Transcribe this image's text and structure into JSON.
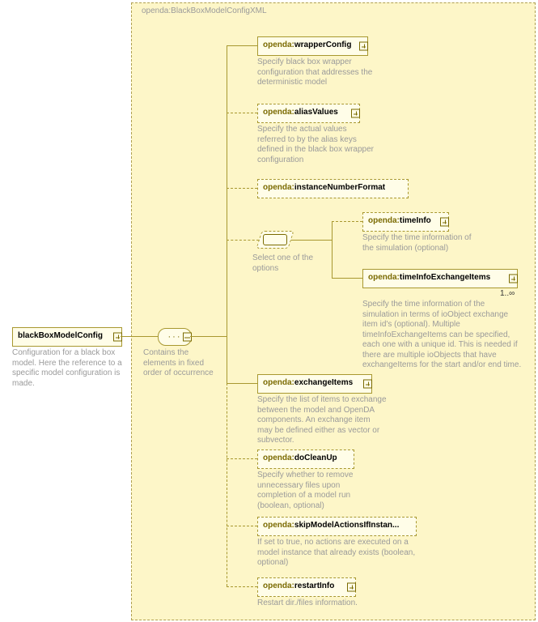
{
  "background": {
    "label": "openda:BlackBoxModelConfigXML"
  },
  "root": {
    "name_ns": "",
    "name_label": "blackBoxModelConfig",
    "description": "Configuration for a black box model. Here the reference to a specific model configuration is made."
  },
  "sequence": {
    "description": "Contains the elements in fixed order of occurrence"
  },
  "choice": {
    "description": "Select one of the options"
  },
  "nodes": {
    "wrapperConfig": {
      "ns": "openda:",
      "label": "wrapperConfig",
      "desc": "Specify black box wrapper configuration that addresses the deterministic model"
    },
    "aliasValues": {
      "ns": "openda:",
      "label": "aliasValues",
      "desc": "Specify the actual values referred to by the alias keys defined in the black box wrapper configuration"
    },
    "instanceNumberFormat": {
      "ns": "openda:",
      "label": "instanceNumberFormat"
    },
    "timeInfo": {
      "ns": "openda:",
      "label": "timeInfo",
      "desc": "Specify the time information of the simulation (optional)"
    },
    "timeInfoExchangeItems": {
      "ns": "openda:",
      "label": "timeInfoExchangeItems",
      "occurrence": "1..∞",
      "desc": "Specify the time information of the simulation in terms of ioObject exchange item id's (optional). Multiple timeInfoExchangeItems can be specified, each one with a unique id. This is needed if there are multiple ioObjects that have exchangeItems for the start and/or end time."
    },
    "exchangeItems": {
      "ns": "openda:",
      "label": "exchangeItems",
      "desc": "Specify the list of items to exchange between the model and OpenDA components. An exchange item may be defined either as vector or subvector."
    },
    "doCleanUp": {
      "ns": "openda:",
      "label": "doCleanUp",
      "desc": "Specify whether to remove unnecessary files upon completion of a model run (boolean, optional)"
    },
    "skipModelActions": {
      "ns": "openda:",
      "label": "skipModelActionsIfInstan...",
      "desc": "If set to true, no actions are executed on a model instance that already exists (boolean, optional)"
    },
    "restartInfo": {
      "ns": "openda:",
      "label": "restartInfo",
      "desc": "Restart dir./files information."
    }
  }
}
